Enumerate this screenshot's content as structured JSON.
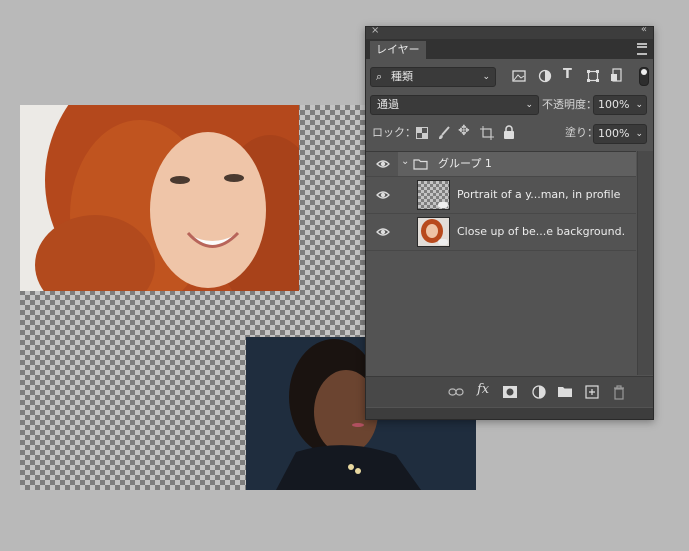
{
  "canvas": {
    "photo1_name": "woman-red-curly-hair",
    "photo2_name": "woman-dark-suit-portrait"
  },
  "panel": {
    "tab_label": "レイヤー",
    "filter": {
      "label": "種類"
    },
    "blend_mode": "通過",
    "opacity_label": "不透明度：",
    "opacity_value": "100%",
    "lock_label": "ロック：",
    "fill_label": "塗り：",
    "fill_value": "100%",
    "layers": [
      {
        "name": "グループ 1",
        "type": "group"
      },
      {
        "name": "Portrait of a y...man, in profile",
        "type": "smart-object"
      },
      {
        "name": "Close up of be...e background.",
        "type": "smart-object"
      }
    ],
    "footer_icons": [
      "link-icon",
      "fx-icon",
      "mask-icon",
      "adjustment-icon",
      "folder-icon",
      "new-layer-icon",
      "trash-icon"
    ],
    "fx_label": "fx"
  }
}
